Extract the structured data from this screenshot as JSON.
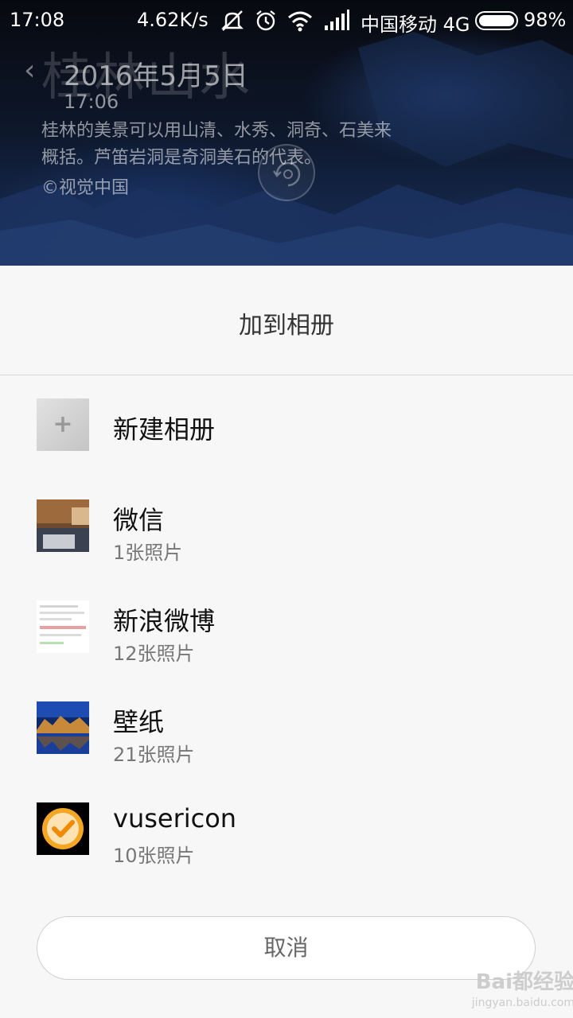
{
  "status_bar": {
    "time": "17:08",
    "net_speed": "4.62K/s",
    "carrier": "中国移动 4G",
    "battery_percent": "98%",
    "icons": [
      "mute-vibrate-icon",
      "alarm-icon",
      "wifi-icon",
      "signal-icon",
      "battery-icon"
    ]
  },
  "photo_overlay": {
    "ghost_title": "桂林山水",
    "date": "2016年5月5日",
    "time": "17:06",
    "description": "桂林的美景可以用山清、水秀、洞奇、石美来概括。芦笛岩洞是奇洞美石的代表。",
    "credit": "©视觉中国"
  },
  "sheet": {
    "title": "加到相册",
    "new_album": {
      "label": "新建相册"
    },
    "albums": [
      {
        "name": "微信",
        "count": "1张照片"
      },
      {
        "name": "新浪微博",
        "count": "12张照片"
      },
      {
        "name": "壁纸",
        "count": "21张照片"
      },
      {
        "name": "vusericon",
        "count": "10张照片"
      }
    ],
    "cancel_label": "取消"
  },
  "watermark": {
    "logo": "Bai都经验",
    "url": "jingyan.baidu.com"
  },
  "colors": {
    "sheet_bg": "#f7f7f7",
    "accent_orange": "#f5a623",
    "text_primary": "#111111",
    "text_secondary": "#777777"
  }
}
